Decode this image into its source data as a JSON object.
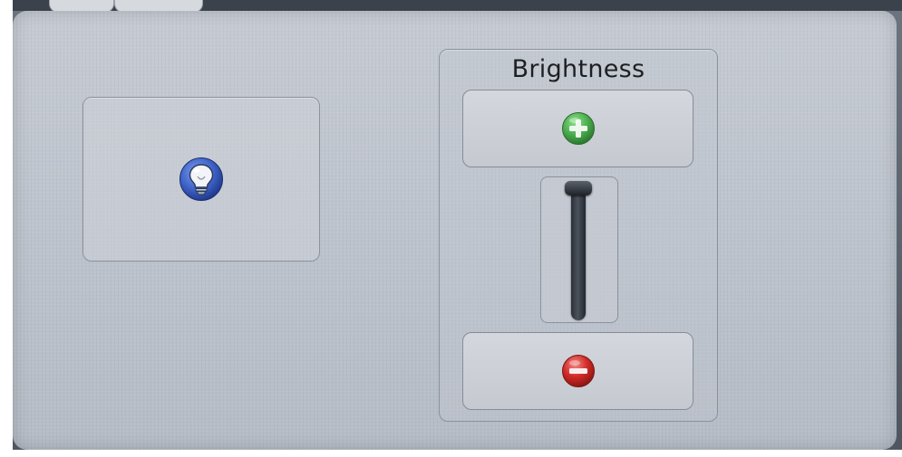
{
  "brightness": {
    "title": "Brightness",
    "level": 1.0
  },
  "icons": {
    "light": "light-bulb-icon",
    "increase": "plus-icon",
    "decrease": "minus-icon"
  },
  "colors": {
    "bulb_blue": "#3f63c8",
    "plus_green": "#4caf50",
    "minus_red": "#d12a26"
  }
}
